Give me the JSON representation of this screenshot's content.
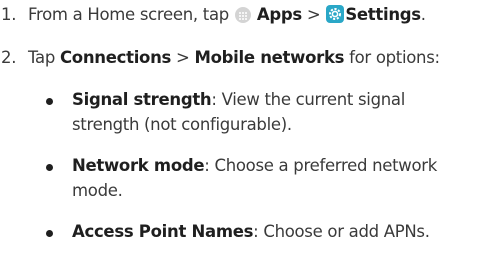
{
  "steps": [
    {
      "number": "1.",
      "pre": "From a Home screen, tap",
      "apps": "Apps",
      "separator": ">",
      "settings": "Settings",
      "post": "."
    },
    {
      "number": "2.",
      "pre": "Tap",
      "connections": "Connections",
      "separator": ">",
      "mobile_networks": "Mobile networks",
      "post": "for options:"
    }
  ],
  "options": [
    {
      "title": "Signal strength",
      "colon": ":",
      "desc_line1": "View the current signal",
      "desc_line2": "strength (not configurable)."
    },
    {
      "title": "Network mode",
      "colon": ":",
      "desc_line1": "Choose a preferred network",
      "desc_line2": "mode."
    },
    {
      "title": "Access Point Names",
      "colon": ":",
      "desc_line1": "Choose or add APNs."
    }
  ],
  "icons": {
    "apps": "apps-grid-icon",
    "settings": "settings-gear-icon",
    "settings_color": "#2aa7c7"
  }
}
